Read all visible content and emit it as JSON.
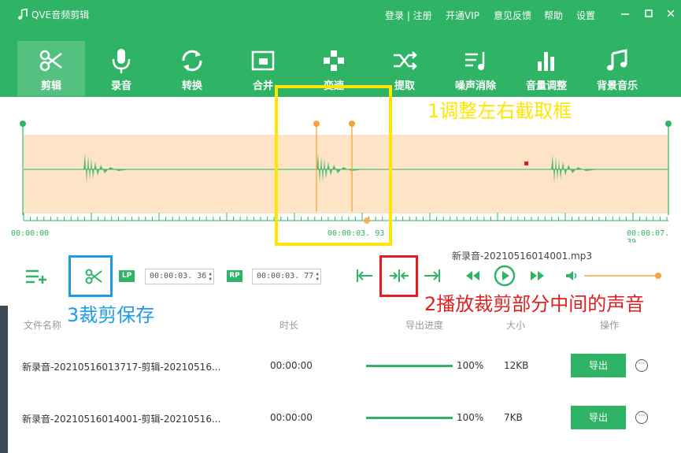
{
  "app": {
    "title": "QVE音频剪辑",
    "menu": [
      "登录 | 注册",
      "开通VIP",
      "意见反馈",
      "帮助",
      "设置"
    ]
  },
  "toolbar": [
    {
      "label": "剪辑",
      "icon": "scissors-icon"
    },
    {
      "label": "录音",
      "icon": "microphone-icon"
    },
    {
      "label": "转换",
      "icon": "convert-icon"
    },
    {
      "label": "合并",
      "icon": "merge-icon"
    },
    {
      "label": "变速",
      "icon": "speed-icon"
    },
    {
      "label": "提取",
      "icon": "extract-icon"
    },
    {
      "label": "噪声消除",
      "icon": "noise-icon"
    },
    {
      "label": "音量调整",
      "icon": "volume-bars-icon"
    },
    {
      "label": "背景音乐",
      "icon": "music-note-icon"
    }
  ],
  "waveform": {
    "start_time": "00:00:00",
    "marker_time": "00:00:03. 93",
    "end_time": "00:00:07. 39"
  },
  "controls": {
    "file_name": "新录音-20210516014001.mp3",
    "lp_label": "LP",
    "lp_time": "00:00:03. 36",
    "rp_label": "RP",
    "rp_time": "00:00:03. 77"
  },
  "annotations": {
    "adjust": "1调整左右截取框",
    "play_middle": "2播放裁剪部分中间的声音",
    "save": "3裁剪保存"
  },
  "table": {
    "headers": [
      "文件名称",
      "时长",
      "导出进度",
      "大小",
      "操作"
    ],
    "rows": [
      {
        "name": "新录音-20210516013717-剪辑-20210516...",
        "duration": "00:00:00",
        "progress": 1.0,
        "progress_label": "100%",
        "size": "12KB",
        "action": "导出"
      },
      {
        "name": "新录音-20210516014001-剪辑-20210516...",
        "duration": "00:00:00",
        "progress": 1.0,
        "progress_label": "100%",
        "size": "7KB",
        "action": "导出"
      }
    ]
  },
  "colors": {
    "brand": "#2fb466",
    "selection": "#fde4c6",
    "handle": "#f5a33c",
    "anno_yellow": "#ffe600",
    "anno_red": "#e02020",
    "anno_blue": "#1e9be8"
  }
}
